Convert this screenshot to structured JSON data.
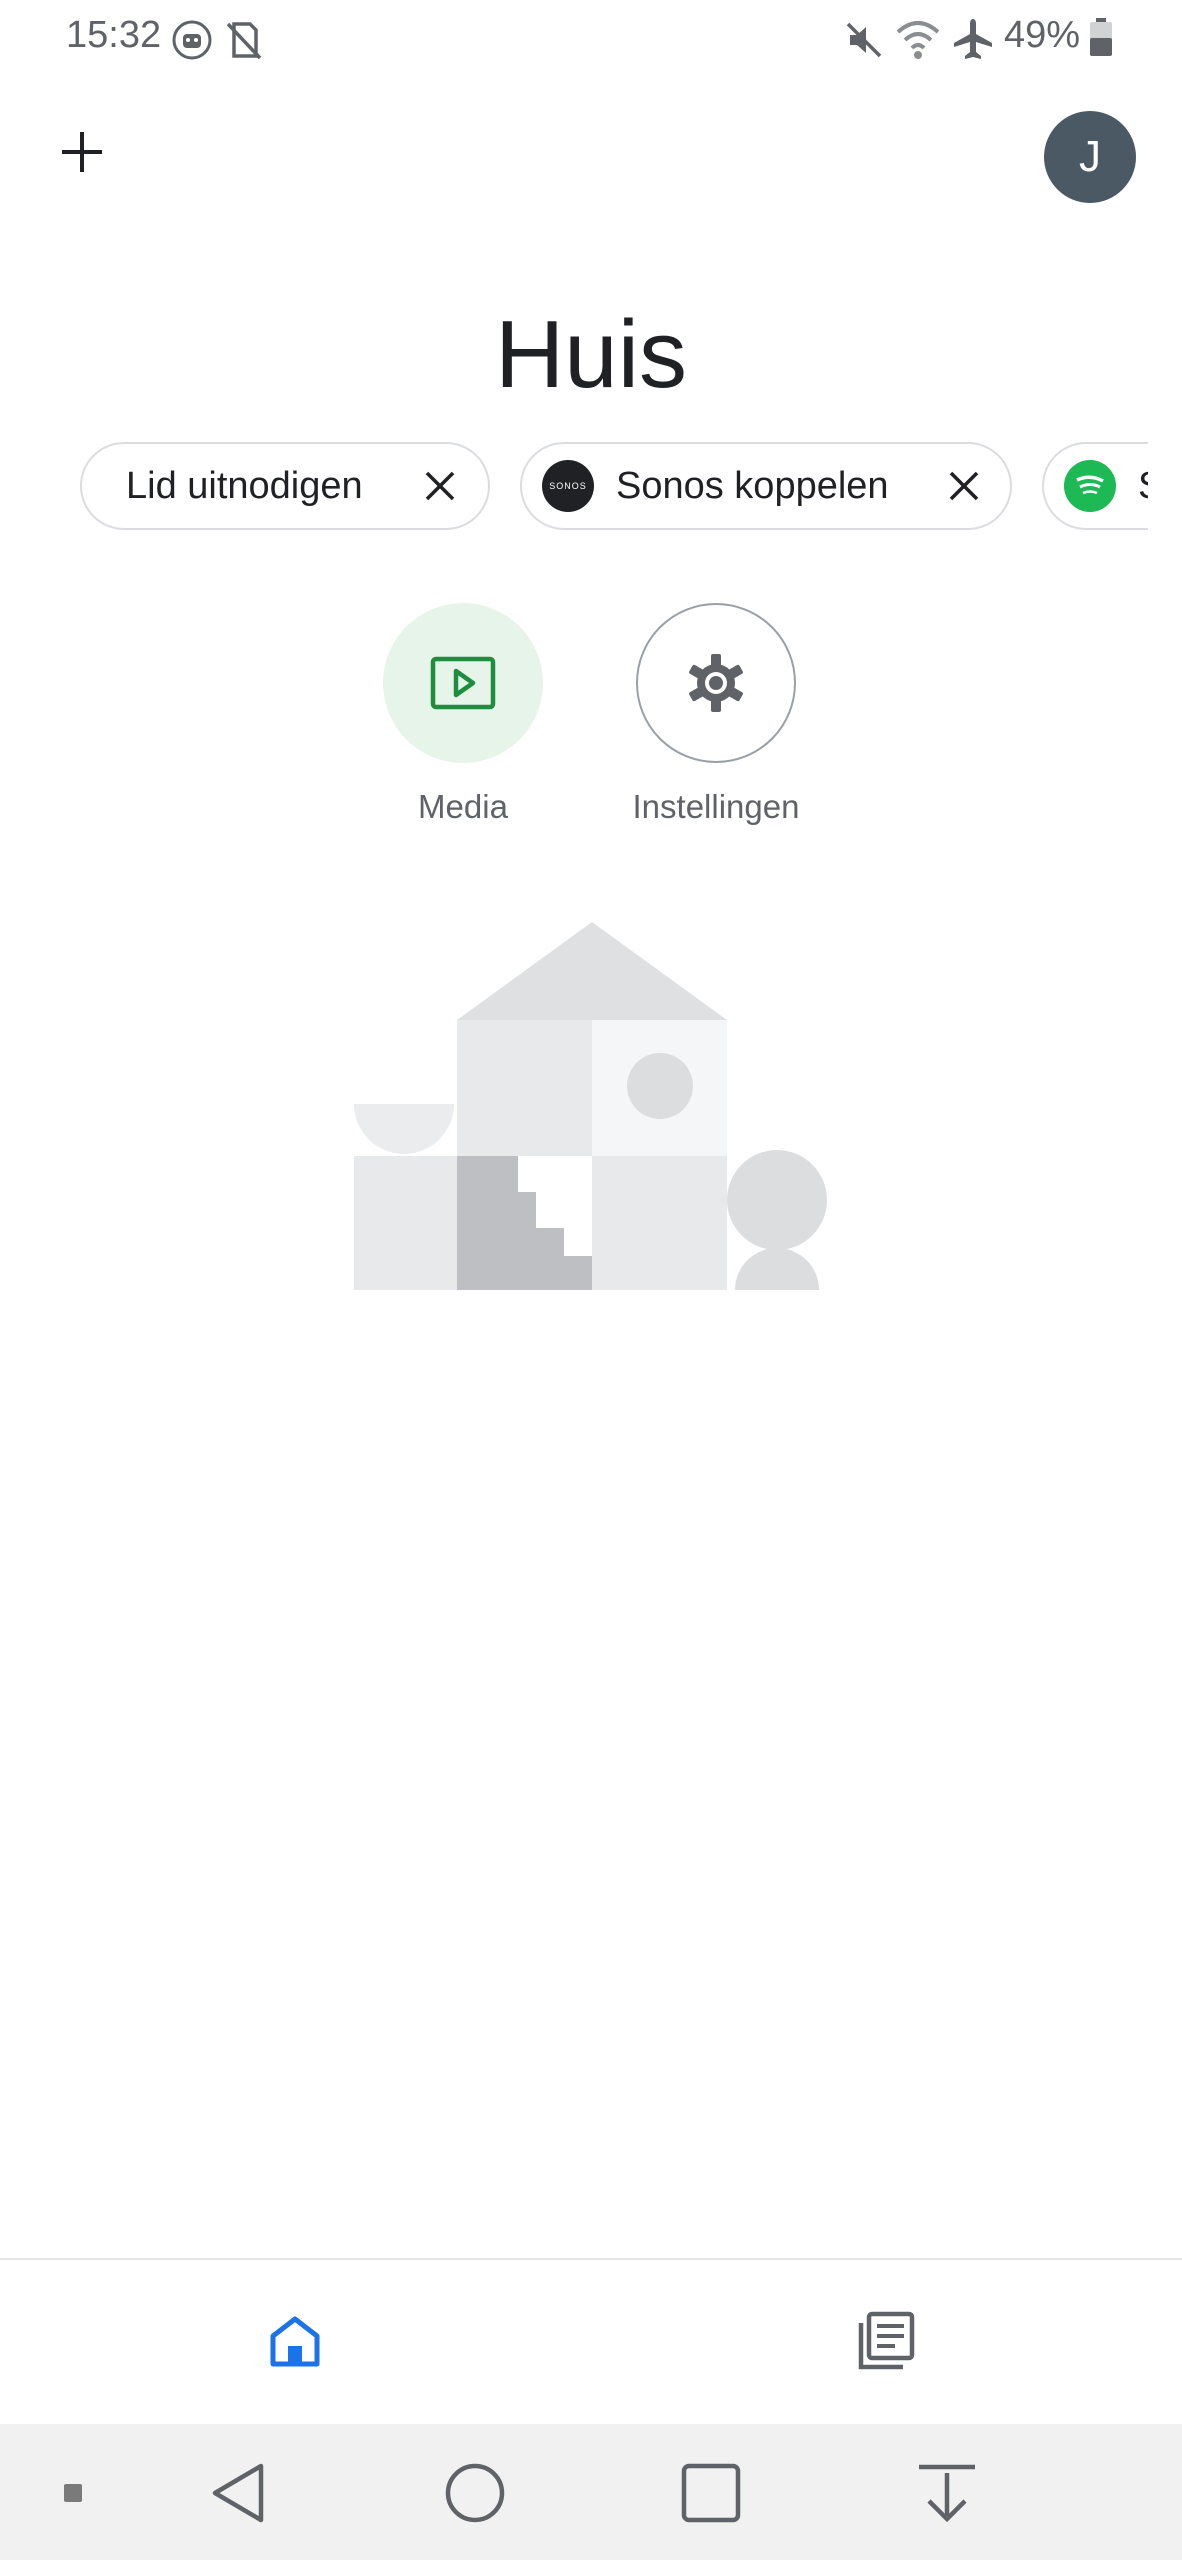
{
  "status_bar": {
    "time": "15:32",
    "battery_percent": "49%",
    "icons": [
      "android-debug-icon",
      "no-sim-icon",
      "mute-icon",
      "wifi-icon",
      "airplane-mode-icon",
      "battery-icon"
    ]
  },
  "header": {
    "add_icon": "plus-icon",
    "avatar_letter": "J",
    "title": "Huis"
  },
  "chips": [
    {
      "label": "Lid uitnodigen",
      "icon": "close-icon"
    },
    {
      "label": "Sonos koppelen",
      "logo": "sonos-logo",
      "logo_text": "SONOS",
      "icon": "close-icon"
    },
    {
      "label": "S",
      "logo": "spotify-logo"
    }
  ],
  "quick_actions": [
    {
      "label": "Media",
      "icon": "play-box-icon"
    },
    {
      "label": "Instellingen",
      "icon": "gear-icon"
    }
  ],
  "bottom_nav": [
    {
      "name": "home",
      "icon": "home-icon",
      "active": true
    },
    {
      "name": "feed",
      "icon": "feed-icon",
      "active": false
    }
  ],
  "colors": {
    "accent_blue": "#1a73e8",
    "media_green": "#1e8e3e",
    "media_bg": "#e6f4ea",
    "avatar_bg": "#4a5964",
    "spotify_green": "#1db954"
  }
}
